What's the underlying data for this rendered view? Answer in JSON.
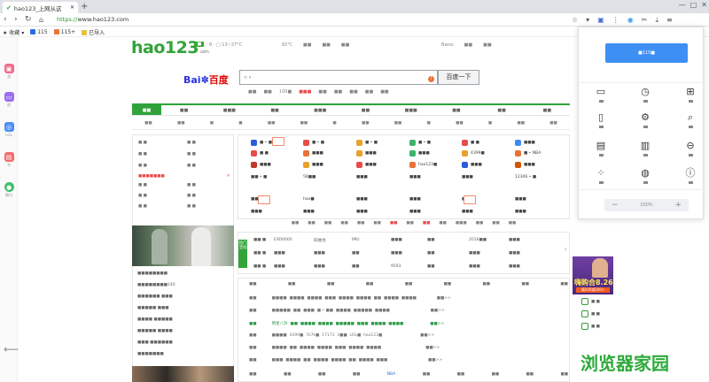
{
  "browser": {
    "tab_title": "hao123_上网从这",
    "url_scheme": "https://",
    "url_rest": "www.hao123.com",
    "new_tab_glyph": "+",
    "window_controls": [
      "—",
      "□",
      "✕"
    ]
  },
  "bookmarks": {
    "favorites_label": "收藏",
    "items": [
      "115",
      "115+",
      "已导入"
    ]
  },
  "left_sidebar": {
    "items": [
      {
        "label": "游",
        "color": "#f36c8e"
      },
      {
        "label": "视",
        "color": "#9b6ef3"
      },
      {
        "label": "LOL",
        "color": "#4c8ef6"
      },
      {
        "label": "书",
        "color": "#f36c6c"
      },
      {
        "label": "腾讯",
        "color": "#3dbf6a"
      }
    ]
  },
  "header": {
    "logo": "hao123",
    "logo_suffix": ".com",
    "tag": "■",
    "weather": "8 ·  □ 13~27°C",
    "links": [
      "82℃",
      "■■",
      "■■",
      "■■"
    ],
    "user_links": [
      "Bwoo",
      "■■",
      "■■"
    ]
  },
  "search": {
    "baidu_logo": "百度",
    "baidu_prefix": "Bai",
    "placeholder": "≡  ▾",
    "badge": "!",
    "button": "百度一下",
    "tabs": [
      "■■",
      "■■",
      "100■",
      "■■■",
      "■■",
      "■■",
      "■■",
      "■■",
      "■■"
    ]
  },
  "categories": [
    "■■",
    "■■",
    "■■■",
    "■■",
    "■■■",
    "■■",
    "■■■",
    "■■",
    "■■",
    "■■"
  ],
  "subcategories": [
    "■■",
    "■■",
    "■",
    "■",
    "■■",
    "■■",
    "■",
    "■■",
    "■■",
    "■",
    "■■",
    "■",
    "■■",
    "■■"
  ],
  "left_column": {
    "rows": [
      [
        "■ ■",
        "■ ■"
      ],
      [
        "■ ■",
        "■ ■"
      ],
      [
        "■ ■",
        "■ ■"
      ],
      [
        "■■■■■■■",
        "✕"
      ],
      [
        "■ ■",
        "■ ■"
      ],
      [
        "■ ■",
        "■ ■"
      ],
      [
        "■  ■",
        "■  ■"
      ]
    ],
    "news": [
      "■■■■■■■■",
      "■■■■■■■■140",
      "■■■■■■ ■■■",
      "■■■■■ ■■■",
      "■■■■ ■■■■■",
      "■■■■■ ■■■■",
      "■■■ ■■■■■■",
      "■■■■■■■"
    ]
  },
  "grid_sites": [
    {
      "t": "■ • ■",
      "c": "#2b5bdc"
    },
    {
      "t": "■ • ■",
      "c": "#e94b4b"
    },
    {
      "t": "■ • ■",
      "c": "#e8a22a"
    },
    {
      "t": "■ • ■",
      "c": "#3db36a"
    },
    {
      "t": "■ ■",
      "c": "#e94b4b"
    },
    {
      "t": "■■■",
      "c": "#3d8bf0"
    },
    {
      "t": "■ ■",
      "c": "#e94b4b"
    },
    {
      "t": "■■■",
      "c": "#e8733a"
    },
    {
      "t": "■■■",
      "c": "#e8a22a"
    },
    {
      "t": "■■■",
      "c": "#3db36a"
    },
    {
      "t": "4399■",
      "c": "#e8a22a"
    },
    {
      "t": "■ • NBA",
      "c": "#e8733a"
    },
    {
      "t": "■■■",
      "c": "#c0392b"
    },
    {
      "t": "■■■",
      "c": "#e8a22a"
    },
    {
      "t": "■■■",
      "c": "#e94b4b"
    },
    {
      "t": "hao123■",
      "c": "#e8733a"
    },
    {
      "t": "■■■",
      "c": "#2b5bdc"
    },
    {
      "t": "■■■",
      "c": "#d35400"
    },
    {
      "t": "■■ • ■",
      "c": ""
    },
    {
      "t": "58■■",
      "c": ""
    },
    {
      "t": "■■■",
      "c": ""
    },
    {
      "t": "■■■",
      "c": ""
    },
    {
      "t": "■■■",
      "c": ""
    },
    {
      "t": "12306 • ■",
      "c": ""
    },
    {
      "t": "■■■",
      "c": ""
    },
    {
      "t": "hao■",
      "c": ""
    },
    {
      "t": "■■■",
      "c": ""
    },
    {
      "t": "■■■",
      "c": ""
    },
    {
      "t": "■■■",
      "c": ""
    },
    {
      "t": "■■■",
      "c": ""
    },
    {
      "t": "■■■",
      "c": ""
    },
    {
      "t": "■■■",
      "c": ""
    },
    {
      "t": "■■■",
      "c": ""
    },
    {
      "t": "■■■",
      "c": ""
    },
    {
      "t": "■■■",
      "c": ""
    },
    {
      "t": "■■■",
      "c": ""
    }
  ],
  "mid_strip": [
    "■■",
    "■■",
    "■■",
    "■■",
    "■■",
    "■■",
    "■■",
    "■■",
    "■■",
    "■■",
    "■■■",
    "■■",
    "■■",
    "■■"
  ],
  "section2": {
    "label": "热门活动",
    "rows": [
      [
        "■■ ■",
        "EXO0000",
        "四维地",
        "IMU",
        "■■■",
        "■■",
        "2016■■",
        "■■■"
      ],
      [
        "■■ ■",
        "■■■",
        "■■■",
        "■■",
        "■■■",
        "■■",
        "■■■",
        "■■■"
      ],
      [
        "■■ ■",
        "■■■",
        "■■■",
        "■■",
        "9593",
        "■■",
        "■■■",
        "■■■"
      ]
    ]
  },
  "section3": {
    "header": [
      "■■",
      "■■",
      "■■",
      "■■",
      "■■",
      "■■",
      "■■",
      "■■",
      "■■"
    ],
    "rows": [
      "■■            ■■■■  ■■■■  ■■■■  ■■■  ■■■■  ■■■■  ■■  ■■■■  ■■■■                ■■>>",
      "■■            ■■■■■  ■■  ■■■  ■ • ■■  ■■■■  ■■■■■  ■■■■                                ■■>>",
      "■■            明星八卦  ■■  ■■■■  ■■■■  ■■■■■  ■■■  ■■■■  ■■■■                     ■■>>",
      "■■            ■■■■  4399■  7k7k■  17173  3■■  LOL■  hao123■                              ■■>>",
      "■■            ■■■■  ■■  ■■■■  ■■■■  ■■■  ■■■■  ■■■■                                   ■■>>",
      "■■            ■■■  ■■■■  ■■  ■■■■  ■■■■  ■■  ■■■■  ■■■                                ■■>>"
    ],
    "footer": [
      "■■",
      "■■",
      "■■",
      "■■",
      "NBA",
      "■■",
      "■■",
      "■■",
      "■■",
      "■■"
    ]
  },
  "panel": {
    "button": "■115■",
    "icons": [
      "window-icon",
      "clock-icon",
      "basket-icon",
      "file-icon",
      "gear-icon",
      "search-icon",
      "briefcase-icon",
      "book-icon",
      "gamepad-icon",
      "apps-icon",
      "swirl-icon",
      "info-icon"
    ],
    "zoom": {
      "minus": "−",
      "value": "100%",
      "plus": "+"
    }
  },
  "ad": {
    "title": "嗨购合8.26",
    "sub": "满100减100+"
  },
  "right_links": [
    "■ ■",
    "■ ■",
    "■ ■"
  ],
  "watermark": "浏览器家园"
}
